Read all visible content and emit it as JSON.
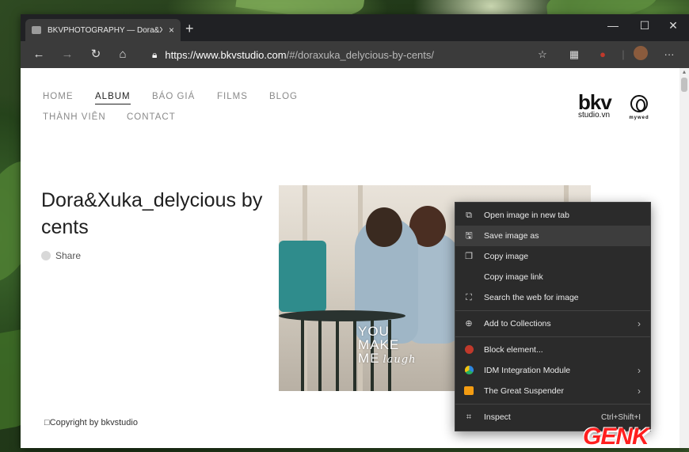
{
  "browser": {
    "tab_title": "BKVPHOTOGRAPHY — Dora&Xu",
    "tab_close": "×",
    "new_tab": "+",
    "window_controls": {
      "minimize": "—",
      "maximize": "☐",
      "close": "✕"
    },
    "nav_icons": [
      "back-icon",
      "forward-icon",
      "refresh-icon",
      "home-icon"
    ],
    "url_prefix": "https://",
    "url_host": "www.bkvstudio.com",
    "url_path": "/#/doraxuka_delycious-by-cents/"
  },
  "site": {
    "nav": [
      "HOME",
      "ALBUM",
      "BÁO GIÁ",
      "FILMS",
      "BLOG",
      "THÀNH VIÊN",
      "CONTACT"
    ],
    "active_nav": "ALBUM",
    "logo_text": "bkv",
    "logo_sub": "studio.vn",
    "partner_logo": "mywed",
    "album_title": "Dora&Xuka_delycious by cents",
    "share_label": "Share",
    "photo_caption": "YOU\nMAKE\nME",
    "photo_caption_script": "laugh",
    "copyright": "Copyright by bkvstudio"
  },
  "context_menu": {
    "items": [
      {
        "label": "Open image in new tab",
        "icon": "open-tab-icon"
      },
      {
        "label": "Save image as",
        "icon": "save-image-icon",
        "highlighted": true
      },
      {
        "label": "Copy image",
        "icon": "copy-image-icon"
      },
      {
        "label": "Copy image link",
        "icon": ""
      },
      {
        "label": "Search the web for image",
        "icon": "search-image-icon"
      },
      {
        "label": "Add to Collections",
        "icon": "collections-icon",
        "submenu": true
      },
      {
        "label": "Block element...",
        "icon": "ublock-icon"
      },
      {
        "label": "IDM Integration Module",
        "icon": "idm-icon",
        "submenu": true
      },
      {
        "label": "The Great Suspender",
        "icon": "suspender-icon",
        "submenu": true
      },
      {
        "label": "Inspect",
        "icon": "inspect-icon",
        "shortcut": "Ctrl+Shift+I"
      }
    ]
  },
  "watermark": "GENK",
  "colors": {
    "menu_bg": "#2b2b2b",
    "menu_highlight": "#3d3d3d",
    "chrome_dark": "#202124",
    "toolbar": "#3b3b3b",
    "watermark_red": "#ff1f1f"
  }
}
